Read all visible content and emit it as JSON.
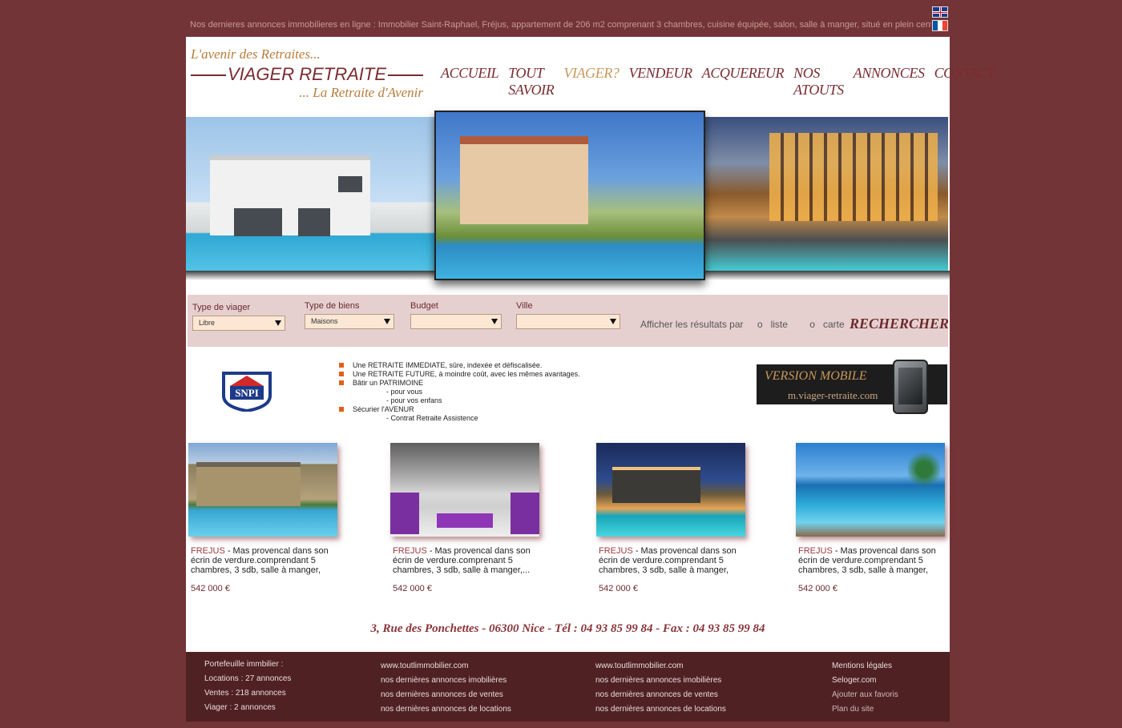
{
  "ticker": "Nos dernieres annonces immobilieres en ligne : Immobilier Saint-Raphael, Fréjus, appartement de 206 m2 comprenant 3 chambres, cuisine équipée, salon, salle à manger, situé en plein centre...",
  "languages": [
    "English",
    "Français"
  ],
  "logo": {
    "tagline_top": "L'avenir des Retraites...",
    "brand": "VIAGER RETRAITE",
    "tagline_bottom": "... La Retraite d'Avenir"
  },
  "nav": [
    {
      "label": "ACCUEIL",
      "active": false
    },
    {
      "label": "TOUT SAVOIR",
      "active": false
    },
    {
      "label": "VIAGER?",
      "active": true
    },
    {
      "label": "VENDEUR",
      "active": false
    },
    {
      "label": "ACQUEREUR",
      "active": false
    },
    {
      "label": "NOS ATOUTS",
      "active": false
    },
    {
      "label": "ANNONCES",
      "active": false
    },
    {
      "label": "CONTACT",
      "active": false
    }
  ],
  "search": {
    "fields": [
      {
        "label": "Type de viager",
        "value": "Libre"
      },
      {
        "label": "Type de biens",
        "value": "Maisons"
      },
      {
        "label": "Budget",
        "value": ""
      },
      {
        "label": "Ville",
        "value": ""
      }
    ],
    "results_label": "Afficher les résultats par",
    "option_list": "liste",
    "option_map": "carte",
    "option_marker": "o",
    "submit": "RECHERCHER"
  },
  "snpi": "SNPI",
  "bullets": [
    {
      "text": "Une RETRAITE IMMEDIATE, sûre, indexée et défiscalisée.",
      "sub": false
    },
    {
      "text": "Une RETRAITE FUTURE, à moindre coût, avec les mêmes avantages.",
      "sub": false
    },
    {
      "text": "Bâtir un PATRIMOINE",
      "sub": false
    },
    {
      "text": "- pour vous",
      "sub": true
    },
    {
      "text": "- pour vos enfans",
      "sub": true
    },
    {
      "text": "Sécurier l'AVENUR",
      "sub": false
    },
    {
      "text": "- Contrat Retraite Assistence",
      "sub": true
    }
  ],
  "mobile": {
    "title": "VERSION MOBILE",
    "url": "m.viager-retraite.com"
  },
  "listings": [
    {
      "city": "FREJUS",
      "desc": " - Mas provencal dans son écrin de verdure.comprendant 5 chambres, 3 sdb, salle à manger,",
      "price": "542 000 €"
    },
    {
      "city": "FREJUS",
      "desc": " - Mas provencal dans son écrin de verdure.comprenant 5 chambres, 3 sdb, salle à manger,...",
      "price": "542 000 €"
    },
    {
      "city": "FREJUS",
      "desc": " - Mas provencal dans son écrin de verdure.comprendant 5 chambres, 3 sdb, salle à manger,",
      "price": "542 000 €"
    },
    {
      "city": "FREJUS",
      "desc": " - Mas provencal dans son écrin de verdure.comprendant 5 chambres, 3 sdb, salle à manger,",
      "price": "542 000 €"
    }
  ],
  "address": "3, Rue des Ponchettes - 06300 Nice - Tél : 04 93 85 99 84 - Fax : 04 93 85 99 84",
  "footer": {
    "portfolio": [
      "Portefeuille immbilier :",
      "Locations : 27 annonces",
      "Ventes : 218 annonces",
      "Viager : 2 annonces"
    ],
    "links_a": [
      "www.toutlimmobilier.com",
      "nos dernières annonces imobilières",
      "nos dernières annonces de ventes",
      "nos dernières annonces de locations"
    ],
    "links_b": [
      "www.toutlimmobilier.com",
      "nos dernières annonces imobilières",
      "nos dernières annonces de ventes",
      "nos dernières annonces de locations"
    ],
    "links_c": [
      "Mentions légales",
      "Seloger.com",
      "Ajouter aux favoris",
      "Plan du site"
    ]
  },
  "colors": {
    "background": "#733437",
    "brand": "#7a2b30",
    "accent": "#c9985a",
    "search_bar": "#e6d0cf",
    "footer": "#502123"
  }
}
